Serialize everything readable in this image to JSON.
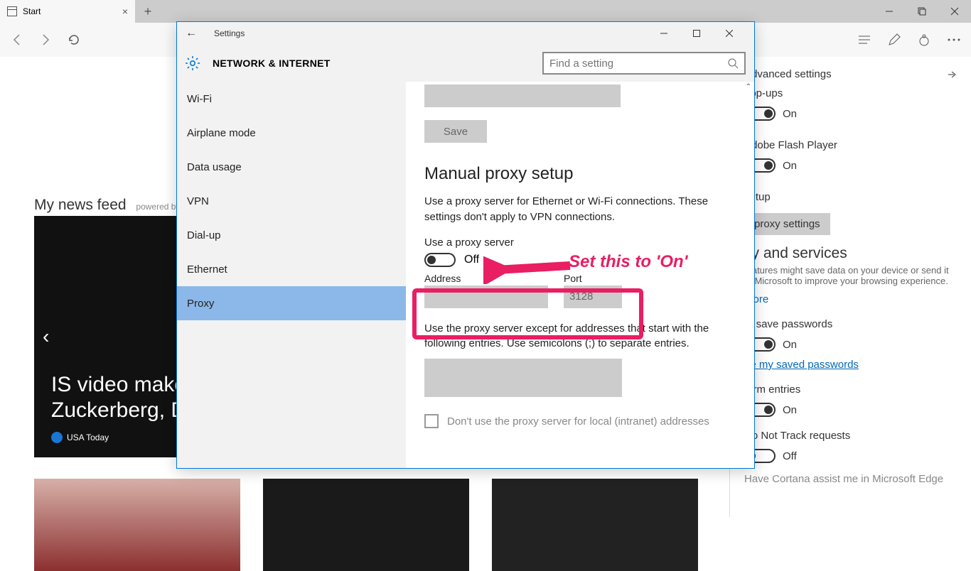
{
  "browser": {
    "tab_title": "Start",
    "news_heading": "My news feed",
    "news_powered": "powered by M",
    "hero_title": "IS video makes threats against Zuckerberg, Do",
    "hero_source": "USA Today"
  },
  "edge_panel": {
    "title": "Advanced settings",
    "popups": "pop-ups",
    "on": "On",
    "off": "Off",
    "flash": "Adobe Flash Player",
    "setup": "setup",
    "proxy_btn": "proxy settings",
    "privacy_heading": "cy and services",
    "privacy_sub": "features might save data on your device or send it to Microsoft to improve your browsing experience.",
    "learn_more": "more",
    "save_pw": "to save passwords",
    "manage_pw": "ge my saved passwords",
    "form_entries": "form entries",
    "dnt": "Do Not Track requests",
    "cortana": "Have Cortana assist me in Microsoft Edge"
  },
  "settings": {
    "window_title": "Settings",
    "category": "NETWORK & INTERNET",
    "search_placeholder": "Find a setting",
    "sidebar": [
      "Wi-Fi",
      "Airplane mode",
      "Data usage",
      "VPN",
      "Dial-up",
      "Ethernet",
      "Proxy"
    ],
    "save": "Save",
    "manual_heading": "Manual proxy setup",
    "manual_desc": "Use a proxy server for Ethernet or Wi-Fi connections. These settings don't apply to VPN connections.",
    "use_proxy_label": "Use a proxy server",
    "toggle_state": "Off",
    "address_label": "Address",
    "port_label": "Port",
    "port_value": "3128",
    "except_desc": "Use the proxy server except for addresses that start with the following entries. Use semicolons (;) to separate entries.",
    "local_chk": "Don't use the proxy server for local (intranet) addresses"
  },
  "annotation": {
    "text": "Set this to 'On'"
  }
}
